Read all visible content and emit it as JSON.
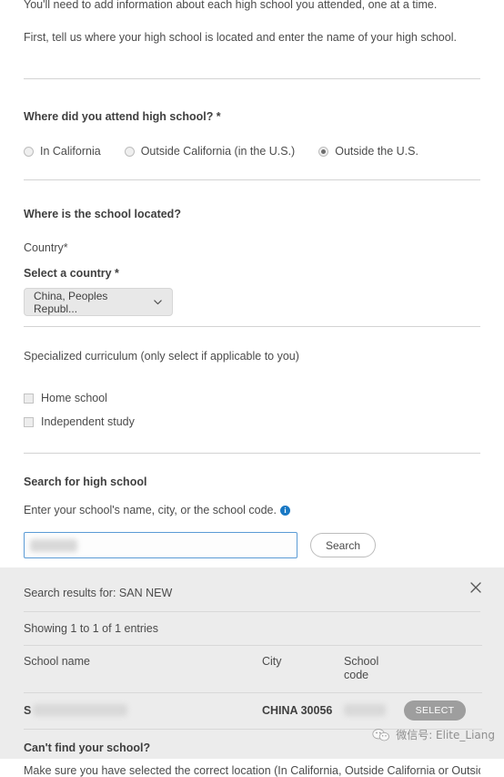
{
  "intro": {
    "paragraph1": "You'll need to add information about each high school you attended, one at a time.",
    "paragraph2": "First, tell us where your high school is located and enter the name of your high school."
  },
  "location_question": {
    "heading": "Where did you attend high school? *",
    "options": [
      {
        "label": "In California",
        "selected": false
      },
      {
        "label": "Outside California (in the U.S.)",
        "selected": false
      },
      {
        "label": "Outside the U.S.",
        "selected": true
      }
    ]
  },
  "school_location": {
    "heading": "Where is the school located?",
    "country_label": "Country*",
    "select_label": "Select a country *",
    "selected_country": "China, Peoples Republ...",
    "chevron_icon": "chevron-down-icon"
  },
  "curriculum": {
    "heading": "Specialized curriculum (only select if applicable to you)",
    "options": [
      {
        "label": "Home school",
        "checked": false
      },
      {
        "label": "Independent study",
        "checked": false
      }
    ]
  },
  "search": {
    "heading": "Search for high school",
    "hint": "Enter your school's name, city, or the school code.",
    "info_icon": "info-icon",
    "input_value": "",
    "input_placeholder": "",
    "button_label": "Search"
  },
  "results": {
    "title": "Search results for: SAN NEW",
    "showing": "Showing 1 to 1 of 1 entries",
    "close_icon": "close-icon",
    "columns": [
      "School name",
      "City",
      "School code",
      ""
    ],
    "rows": [
      {
        "school_name": "S",
        "city": "CHINA 30056",
        "school_code": "",
        "action_label": "SELECT"
      }
    ],
    "cant_find_heading": "Can't find your school?",
    "cant_find_body": "Make sure you have selected the correct location (In California, Outside California or Outside"
  },
  "watermark": {
    "logo_icon": "wechat-icon",
    "text": "微信号: Elite_Liang"
  },
  "colors": {
    "accent_blue": "#1878c4",
    "focus_border": "#5b9bd5",
    "panel_bg": "#ececec",
    "select_button": "#9e9e9e",
    "divider": "#d3d3d3"
  }
}
